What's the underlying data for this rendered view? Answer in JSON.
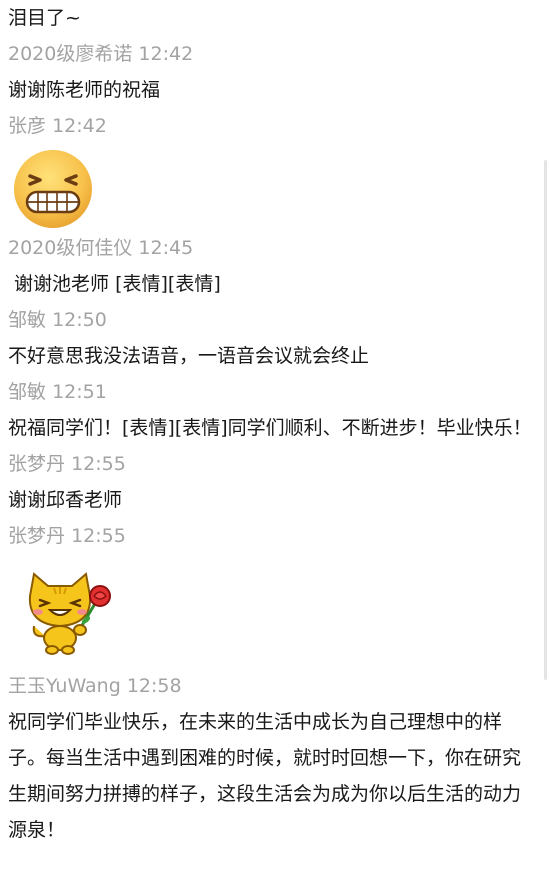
{
  "messages": [
    {
      "type": "text",
      "text": "泪目了~"
    },
    {
      "type": "meta",
      "sender": "2020级廖希诺",
      "time": "12:42"
    },
    {
      "type": "text",
      "text": "谢谢陈老师的祝福"
    },
    {
      "type": "meta",
      "sender": "张彦",
      "time": "12:42"
    },
    {
      "type": "emoji",
      "icon": "grinning-face-emoji-icon"
    },
    {
      "type": "meta",
      "sender": "2020级何佳仪",
      "time": "12:45"
    },
    {
      "type": "text",
      "text": " 谢谢池老师 [表情][表情]"
    },
    {
      "type": "meta",
      "sender": "邹敏",
      "time": "12:50"
    },
    {
      "type": "text",
      "text": "不好意思我没法语音，一语音会议就会终止"
    },
    {
      "type": "meta",
      "sender": "邹敏",
      "time": "12:51"
    },
    {
      "type": "text",
      "text": "祝福同学们！[表情][表情]同学们顺利、不断进步！毕业快乐！"
    },
    {
      "type": "meta",
      "sender": "张梦丹",
      "time": "12:55"
    },
    {
      "type": "text",
      "text": "谢谢邱香老师"
    },
    {
      "type": "meta",
      "sender": "张梦丹",
      "time": "12:55"
    },
    {
      "type": "sticker",
      "icon": "cat-with-rose-sticker-icon"
    },
    {
      "type": "meta",
      "sender": "王玉YuWang",
      "time": "12:58"
    },
    {
      "type": "text",
      "text": "祝同学们毕业快乐，在未来的生活中成长为自己理想中的样子。每当生活中遇到困难的时候，就时时回想一下，你在研究生期间努力拼搏的样子，这段生活会为成为你以后生活的动力源泉！"
    }
  ],
  "colors": {
    "text": "#191919",
    "meta": "#a3a3a3",
    "background": "#ffffff"
  }
}
